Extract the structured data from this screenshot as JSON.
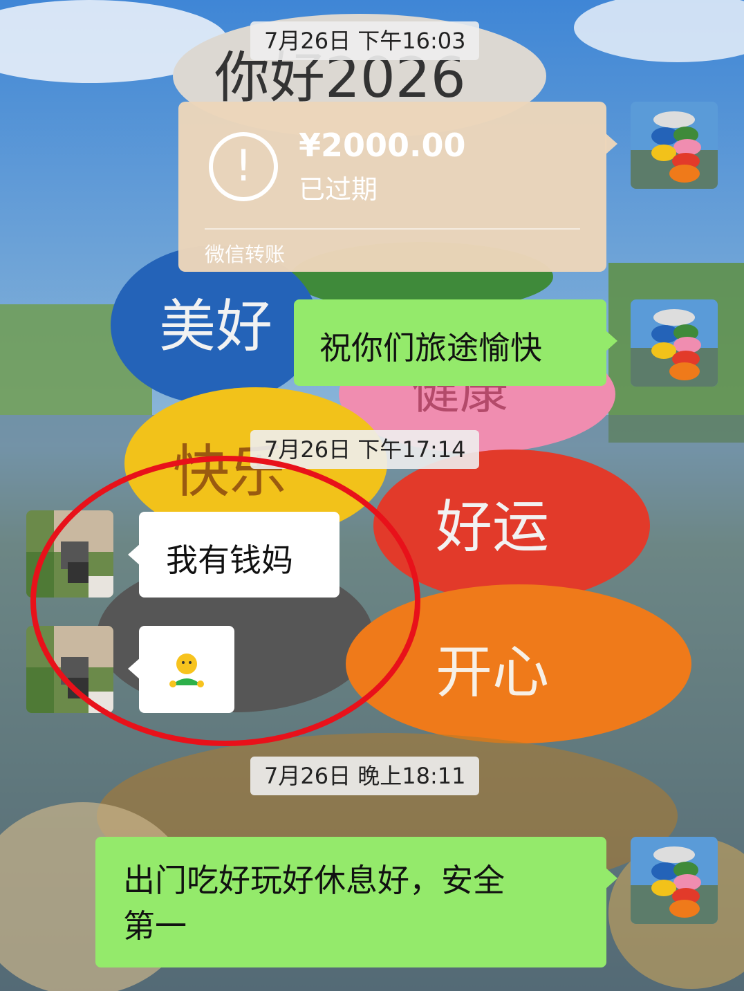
{
  "timestamps": [
    "7月26日 下午16:03",
    "7月26日 下午17:14",
    "7月26日 晚上18:11"
  ],
  "background": {
    "stones": [
      "你好2026",
      "美好",
      "健康",
      "快乐",
      "好运",
      "开心"
    ]
  },
  "messages": {
    "transfer": {
      "amount": "¥2000.00",
      "status": "已过期",
      "label": "微信转账",
      "icon": "exclamation-circle-icon"
    },
    "outgoing_1": "祝你们旅途愉快",
    "incoming_1": "我有钱妈",
    "incoming_2_emoji": "🙂",
    "outgoing_2_line1": "出门吃好玩好休息好，安全",
    "outgoing_2_line2": "第一"
  },
  "colors": {
    "outgoing_bubble": "#94ea6b",
    "incoming_bubble": "#ffffff",
    "transfer_card": "#ecd6ba",
    "annotation_circle": "#e8111a"
  }
}
